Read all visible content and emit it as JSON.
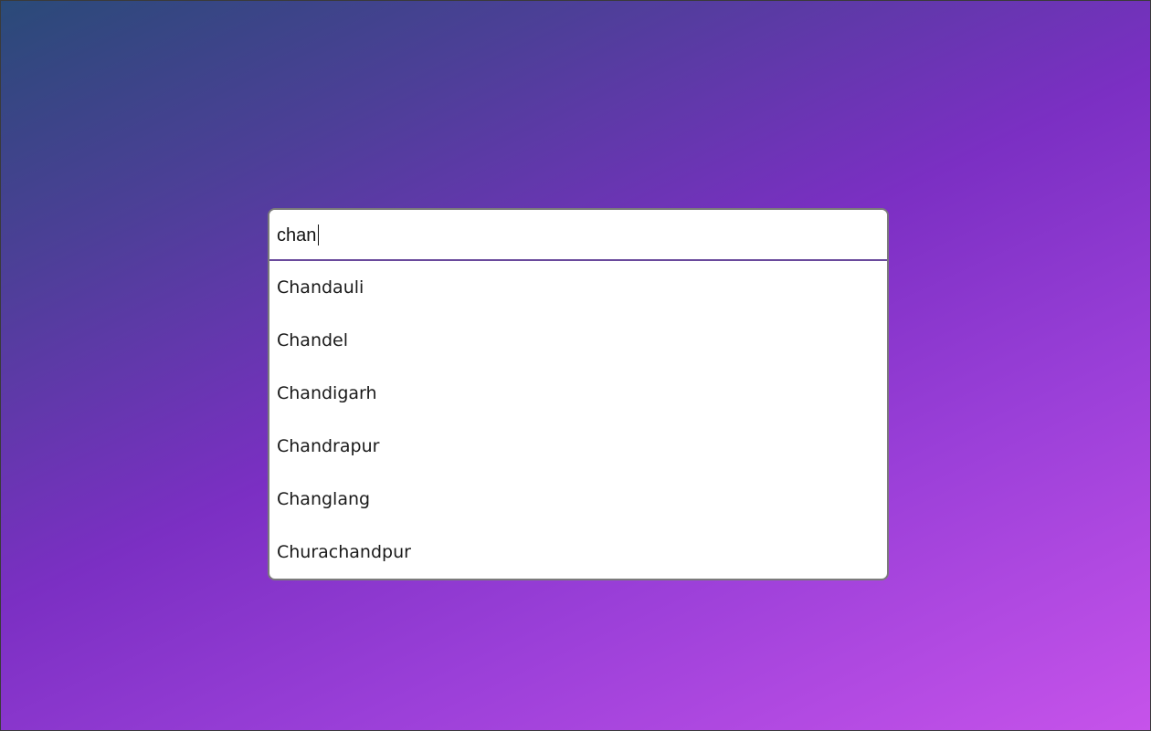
{
  "search": {
    "query": "chan",
    "placeholder": ""
  },
  "suggestions": [
    {
      "label": "Chandauli"
    },
    {
      "label": "Chandel"
    },
    {
      "label": "Chandigarh"
    },
    {
      "label": "Chandrapur"
    },
    {
      "label": "Changlang"
    },
    {
      "label": "Churachandpur"
    }
  ],
  "colors": {
    "gradient_start": "#2a4a78",
    "gradient_mid": "#7b2fc3",
    "gradient_end": "#c653ea",
    "input_underline": "#6a4a9c",
    "panel_border": "#7b7b7b"
  }
}
